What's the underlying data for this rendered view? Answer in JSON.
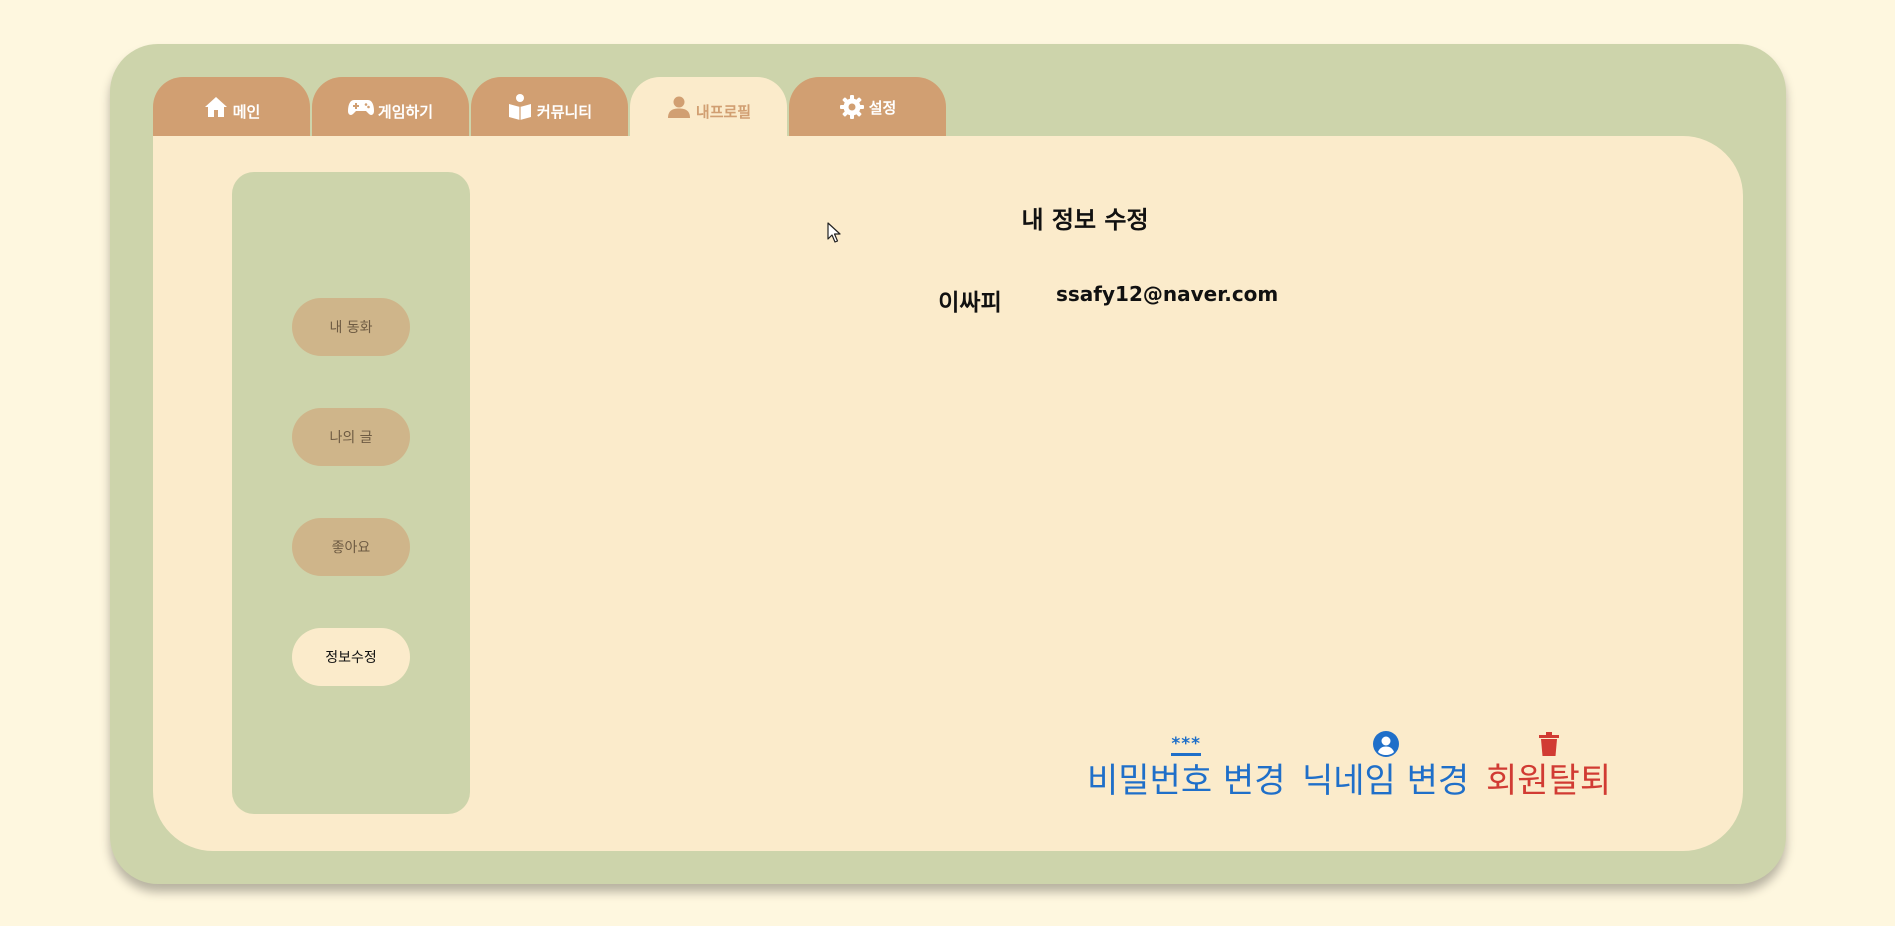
{
  "tabs": [
    {
      "label": "메인",
      "icon": "home-icon"
    },
    {
      "label": "게임하기",
      "icon": "gamepad-icon"
    },
    {
      "label": "커뮤니티",
      "icon": "reading-book-icon"
    },
    {
      "label": "내프로필",
      "icon": "user-icon",
      "active": true
    },
    {
      "label": "설정",
      "icon": "gear-icon"
    }
  ],
  "sidebar": {
    "items": [
      {
        "label": "내 동화"
      },
      {
        "label": "나의 글"
      },
      {
        "label": "좋아요"
      },
      {
        "label": "정보수정",
        "active": true
      }
    ]
  },
  "main": {
    "title": "내 정보 수정",
    "nickname": "이싸피",
    "email": "ssafy12@naver.com"
  },
  "actions": {
    "password": {
      "label": "비밀번호 변경",
      "icon": "asterisks-icon",
      "icon_text": "***"
    },
    "nickname": {
      "label": "닉네임 변경",
      "icon": "user-circle-icon"
    },
    "withdraw": {
      "label": "회원탈퇴",
      "icon": "trash-icon"
    }
  },
  "colors": {
    "background": "#fef7df",
    "frame": "#cdd4ab",
    "panel": "#fbebcb",
    "tab": "#d19f72",
    "sidebar_button": "#cfb58a",
    "action_blue": "#1f6fc9",
    "action_red": "#d13b33"
  }
}
